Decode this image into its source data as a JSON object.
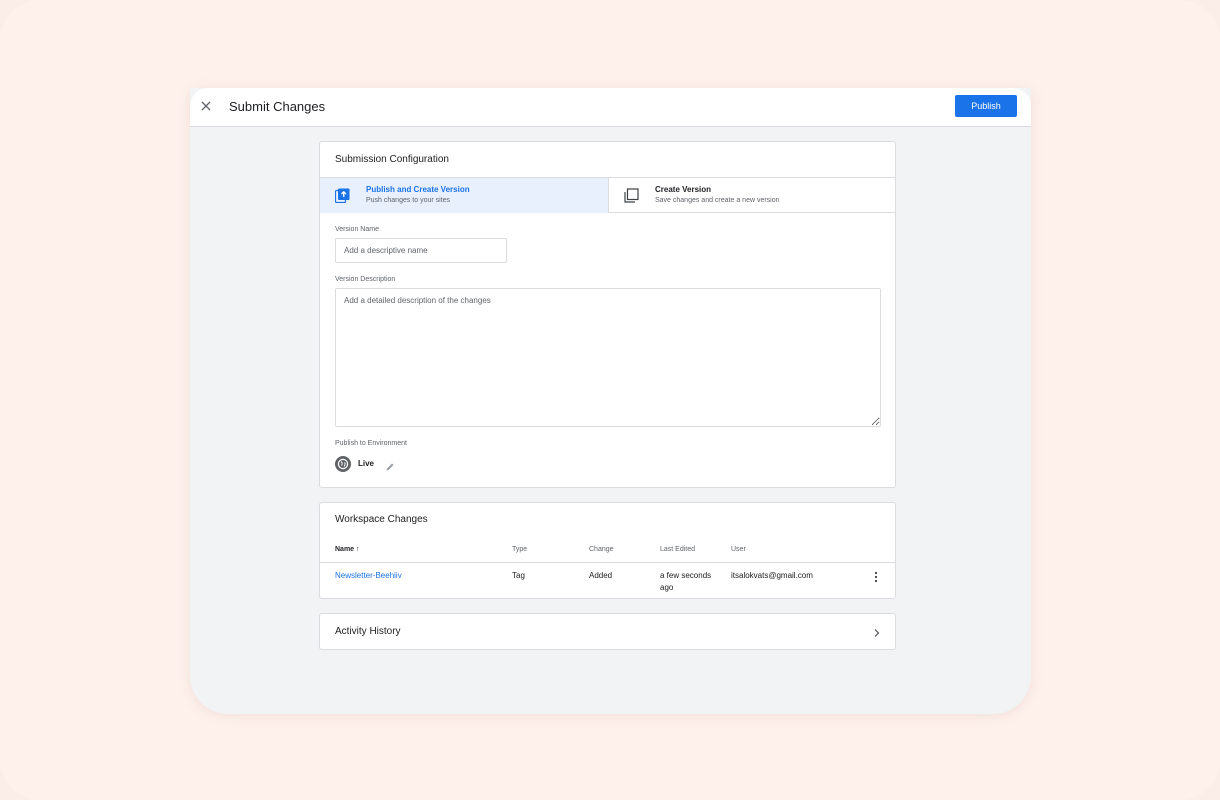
{
  "header": {
    "title": "Submit Changes",
    "publish_label": "Publish"
  },
  "submission": {
    "title": "Submission Configuration",
    "options": [
      {
        "title": "Publish and Create Version",
        "subtitle": "Push changes to your sites",
        "selected": true
      },
      {
        "title": "Create Version",
        "subtitle": "Save changes and create a new version",
        "selected": false
      }
    ],
    "version_name_label": "Version Name",
    "version_name_placeholder": "Add a descriptive name",
    "version_description_label": "Version Description",
    "version_description_placeholder": "Add a detailed description of the changes",
    "environment_label": "Publish to Environment",
    "environment_name": "Live"
  },
  "workspace": {
    "title": "Workspace Changes",
    "columns": [
      "Name",
      "Type",
      "Change",
      "Last Edited",
      "User"
    ],
    "sort_indicator": "↑",
    "rows": [
      {
        "name": "Newsletter-Beehiiv",
        "type": "Tag",
        "change": "Added",
        "last_edited_1": "a few seconds",
        "last_edited_2": "ago",
        "user": "itsalokvats@gmail.com"
      }
    ]
  },
  "activity": {
    "title": "Activity History"
  },
  "colors": {
    "accent": "#1a73e8",
    "selected_bg": "#e8f0fe",
    "page_bg": "#fef1ec",
    "panel_bg": "#f1f3f4"
  }
}
